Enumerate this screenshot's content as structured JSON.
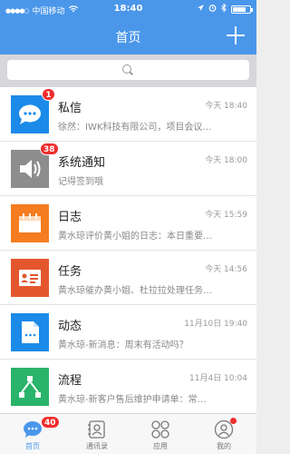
{
  "status_bar": {
    "carrier": "中国移动",
    "time": "18:40"
  },
  "header": {
    "title": "首页"
  },
  "search": {
    "placeholder": ""
  },
  "messages": [
    {
      "title": "私信",
      "time": "今天 18:40",
      "preview": "徐然：IWK科技有限公司，项目会议…",
      "badge": "1",
      "icon": "chat-bubble-icon",
      "color": "#1c8ae8"
    },
    {
      "title": "系统通知",
      "time": "今天 18:00",
      "preview": "记得签到哦",
      "badge": "38",
      "icon": "speaker-icon",
      "color": "#8d8d8d"
    },
    {
      "title": "日志",
      "time": "今天 15:59",
      "preview": "黄水琼评价黄小姐的日志：本日重要…",
      "badge": "",
      "icon": "calendar-icon",
      "color": "#f57c1f"
    },
    {
      "title": "任务",
      "time": "今天 14:56",
      "preview": "黄水琼催办黄小姐、杜拉拉处理任务…",
      "badge": "",
      "icon": "id-card-icon",
      "color": "#e4572e"
    },
    {
      "title": "动态",
      "time": "11月10日 19:40",
      "preview": "黄水琼-新消息：周末有活动吗？",
      "badge": "",
      "icon": "document-icon",
      "color": "#1c8ae8"
    },
    {
      "title": "流程",
      "time": "11月4日 10:04",
      "preview": "黄水琼-新客户售后维护申请单：常…",
      "badge": "",
      "icon": "workflow-icon",
      "color": "#2ab36a"
    }
  ],
  "tabs": [
    {
      "label": "首页",
      "badge": "40",
      "icon": "home-chat-icon",
      "active": true
    },
    {
      "label": "通讯录",
      "badge": "",
      "icon": "contacts-icon",
      "active": false
    },
    {
      "label": "应用",
      "badge": "",
      "icon": "apps-grid-icon",
      "active": false
    },
    {
      "label": "我的",
      "badge": "",
      "icon": "profile-icon",
      "active": false
    }
  ],
  "colors": {
    "primary": "#4a97ea",
    "badge": "#ef2d2d"
  }
}
